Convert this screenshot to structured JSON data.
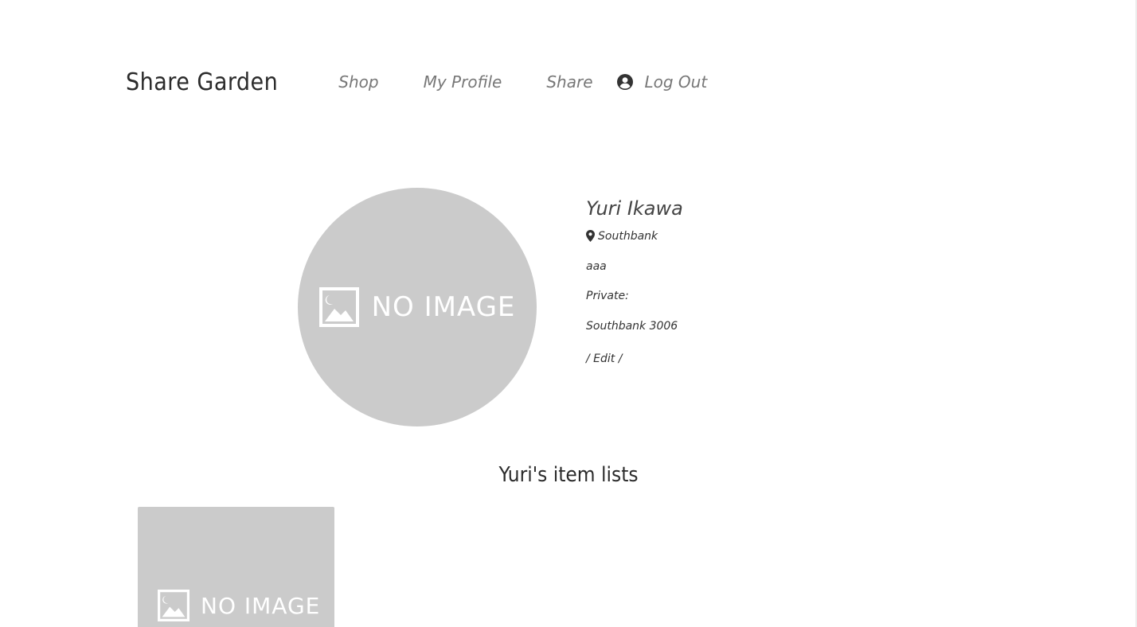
{
  "brand": "Share Garden",
  "nav": {
    "shop": "Shop",
    "profile": "My Profile",
    "share": "Share",
    "logout": "Log Out"
  },
  "profile": {
    "avatar_text": "NO IMAGE",
    "name": "Yuri Ikawa",
    "location": "Southbank",
    "bio": "aaa",
    "private_label": "Private:",
    "address": "Southbank 3006",
    "edit_label": "/ Edit /"
  },
  "items_section": {
    "title": "Yuri's item lists",
    "items": [
      {
        "image_text": "NO IMAGE"
      }
    ]
  },
  "icons": {
    "logout": "user-circle-icon",
    "location": "map-pin-icon",
    "placeholder": "image-icon"
  },
  "colors": {
    "placeholder_bg": "#cbcbcb",
    "nav_text": "#777777"
  }
}
